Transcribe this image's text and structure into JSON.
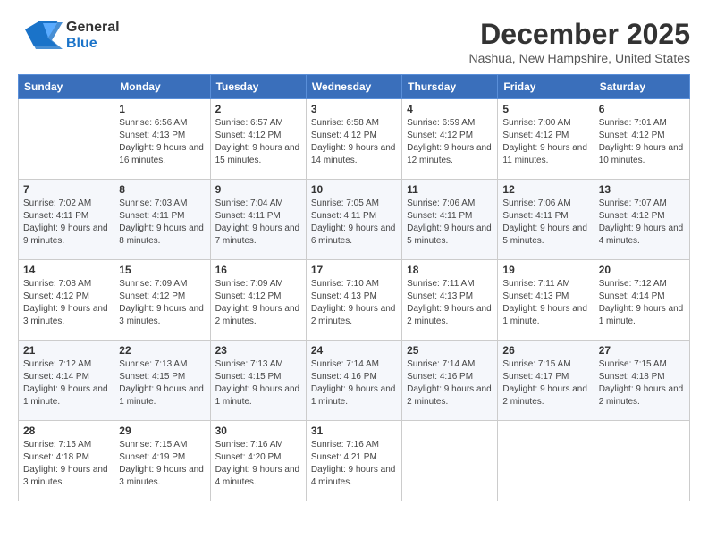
{
  "header": {
    "logo": {
      "general": "General",
      "blue": "Blue"
    },
    "title": "December 2025",
    "location": "Nashua, New Hampshire, United States"
  },
  "calendar": {
    "days_of_week": [
      "Sunday",
      "Monday",
      "Tuesday",
      "Wednesday",
      "Thursday",
      "Friday",
      "Saturday"
    ],
    "weeks": [
      [
        {
          "day": "",
          "sunrise": "",
          "sunset": "",
          "daylight": ""
        },
        {
          "day": "1",
          "sunrise": "Sunrise: 6:56 AM",
          "sunset": "Sunset: 4:13 PM",
          "daylight": "Daylight: 9 hours and 16 minutes."
        },
        {
          "day": "2",
          "sunrise": "Sunrise: 6:57 AM",
          "sunset": "Sunset: 4:12 PM",
          "daylight": "Daylight: 9 hours and 15 minutes."
        },
        {
          "day": "3",
          "sunrise": "Sunrise: 6:58 AM",
          "sunset": "Sunset: 4:12 PM",
          "daylight": "Daylight: 9 hours and 14 minutes."
        },
        {
          "day": "4",
          "sunrise": "Sunrise: 6:59 AM",
          "sunset": "Sunset: 4:12 PM",
          "daylight": "Daylight: 9 hours and 12 minutes."
        },
        {
          "day": "5",
          "sunrise": "Sunrise: 7:00 AM",
          "sunset": "Sunset: 4:12 PM",
          "daylight": "Daylight: 9 hours and 11 minutes."
        },
        {
          "day": "6",
          "sunrise": "Sunrise: 7:01 AM",
          "sunset": "Sunset: 4:12 PM",
          "daylight": "Daylight: 9 hours and 10 minutes."
        }
      ],
      [
        {
          "day": "7",
          "sunrise": "Sunrise: 7:02 AM",
          "sunset": "Sunset: 4:11 PM",
          "daylight": "Daylight: 9 hours and 9 minutes."
        },
        {
          "day": "8",
          "sunrise": "Sunrise: 7:03 AM",
          "sunset": "Sunset: 4:11 PM",
          "daylight": "Daylight: 9 hours and 8 minutes."
        },
        {
          "day": "9",
          "sunrise": "Sunrise: 7:04 AM",
          "sunset": "Sunset: 4:11 PM",
          "daylight": "Daylight: 9 hours and 7 minutes."
        },
        {
          "day": "10",
          "sunrise": "Sunrise: 7:05 AM",
          "sunset": "Sunset: 4:11 PM",
          "daylight": "Daylight: 9 hours and 6 minutes."
        },
        {
          "day": "11",
          "sunrise": "Sunrise: 7:06 AM",
          "sunset": "Sunset: 4:11 PM",
          "daylight": "Daylight: 9 hours and 5 minutes."
        },
        {
          "day": "12",
          "sunrise": "Sunrise: 7:06 AM",
          "sunset": "Sunset: 4:11 PM",
          "daylight": "Daylight: 9 hours and 5 minutes."
        },
        {
          "day": "13",
          "sunrise": "Sunrise: 7:07 AM",
          "sunset": "Sunset: 4:12 PM",
          "daylight": "Daylight: 9 hours and 4 minutes."
        }
      ],
      [
        {
          "day": "14",
          "sunrise": "Sunrise: 7:08 AM",
          "sunset": "Sunset: 4:12 PM",
          "daylight": "Daylight: 9 hours and 3 minutes."
        },
        {
          "day": "15",
          "sunrise": "Sunrise: 7:09 AM",
          "sunset": "Sunset: 4:12 PM",
          "daylight": "Daylight: 9 hours and 3 minutes."
        },
        {
          "day": "16",
          "sunrise": "Sunrise: 7:09 AM",
          "sunset": "Sunset: 4:12 PM",
          "daylight": "Daylight: 9 hours and 2 minutes."
        },
        {
          "day": "17",
          "sunrise": "Sunrise: 7:10 AM",
          "sunset": "Sunset: 4:13 PM",
          "daylight": "Daylight: 9 hours and 2 minutes."
        },
        {
          "day": "18",
          "sunrise": "Sunrise: 7:11 AM",
          "sunset": "Sunset: 4:13 PM",
          "daylight": "Daylight: 9 hours and 2 minutes."
        },
        {
          "day": "19",
          "sunrise": "Sunrise: 7:11 AM",
          "sunset": "Sunset: 4:13 PM",
          "daylight": "Daylight: 9 hours and 1 minute."
        },
        {
          "day": "20",
          "sunrise": "Sunrise: 7:12 AM",
          "sunset": "Sunset: 4:14 PM",
          "daylight": "Daylight: 9 hours and 1 minute."
        }
      ],
      [
        {
          "day": "21",
          "sunrise": "Sunrise: 7:12 AM",
          "sunset": "Sunset: 4:14 PM",
          "daylight": "Daylight: 9 hours and 1 minute."
        },
        {
          "day": "22",
          "sunrise": "Sunrise: 7:13 AM",
          "sunset": "Sunset: 4:15 PM",
          "daylight": "Daylight: 9 hours and 1 minute."
        },
        {
          "day": "23",
          "sunrise": "Sunrise: 7:13 AM",
          "sunset": "Sunset: 4:15 PM",
          "daylight": "Daylight: 9 hours and 1 minute."
        },
        {
          "day": "24",
          "sunrise": "Sunrise: 7:14 AM",
          "sunset": "Sunset: 4:16 PM",
          "daylight": "Daylight: 9 hours and 1 minute."
        },
        {
          "day": "25",
          "sunrise": "Sunrise: 7:14 AM",
          "sunset": "Sunset: 4:16 PM",
          "daylight": "Daylight: 9 hours and 2 minutes."
        },
        {
          "day": "26",
          "sunrise": "Sunrise: 7:15 AM",
          "sunset": "Sunset: 4:17 PM",
          "daylight": "Daylight: 9 hours and 2 minutes."
        },
        {
          "day": "27",
          "sunrise": "Sunrise: 7:15 AM",
          "sunset": "Sunset: 4:18 PM",
          "daylight": "Daylight: 9 hours and 2 minutes."
        }
      ],
      [
        {
          "day": "28",
          "sunrise": "Sunrise: 7:15 AM",
          "sunset": "Sunset: 4:18 PM",
          "daylight": "Daylight: 9 hours and 3 minutes."
        },
        {
          "day": "29",
          "sunrise": "Sunrise: 7:15 AM",
          "sunset": "Sunset: 4:19 PM",
          "daylight": "Daylight: 9 hours and 3 minutes."
        },
        {
          "day": "30",
          "sunrise": "Sunrise: 7:16 AM",
          "sunset": "Sunset: 4:20 PM",
          "daylight": "Daylight: 9 hours and 4 minutes."
        },
        {
          "day": "31",
          "sunrise": "Sunrise: 7:16 AM",
          "sunset": "Sunset: 4:21 PM",
          "daylight": "Daylight: 9 hours and 4 minutes."
        },
        {
          "day": "",
          "sunrise": "",
          "sunset": "",
          "daylight": ""
        },
        {
          "day": "",
          "sunrise": "",
          "sunset": "",
          "daylight": ""
        },
        {
          "day": "",
          "sunrise": "",
          "sunset": "",
          "daylight": ""
        }
      ]
    ]
  }
}
